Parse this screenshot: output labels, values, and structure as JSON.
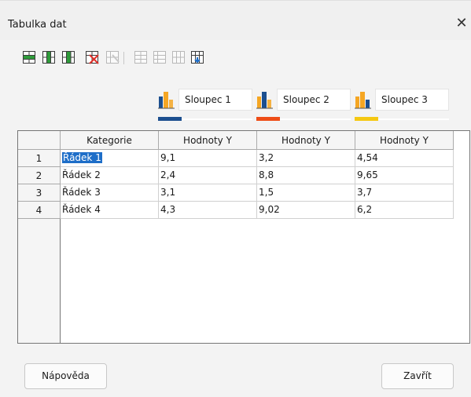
{
  "window": {
    "title": "Tabulka dat",
    "close_glyph": "✕"
  },
  "toolbar": {
    "icons": [
      "insert-row-icon",
      "insert-series-icon",
      "insert-text-column-icon",
      "delete-row-icon",
      "delete-series-icon",
      "move-row-up-icon",
      "move-row-down-icon",
      "move-series-left-icon",
      "move-series-right-icon"
    ]
  },
  "series": [
    {
      "name": "Sloupec 1",
      "color": "#1c4f8f"
    },
    {
      "name": "Sloupec 2",
      "color": "#ee4d17"
    },
    {
      "name": "Sloupec 3",
      "color": "#f5c812"
    }
  ],
  "table": {
    "headers": [
      "Kategorie",
      "Hodnoty Y",
      "Hodnoty Y",
      "Hodnoty Y"
    ],
    "rows": [
      {
        "num": "1",
        "category": "Řádek 1",
        "values": [
          "9,1",
          "3,2",
          "4,54"
        ]
      },
      {
        "num": "2",
        "category": "Řádek 2",
        "values": [
          "2,4",
          "8,8",
          "9,65"
        ]
      },
      {
        "num": "3",
        "category": "Řádek 3",
        "values": [
          "3,1",
          "1,5",
          "3,7"
        ]
      },
      {
        "num": "4",
        "category": "Řádek 4",
        "values": [
          "4,3",
          "9,02",
          "6,2"
        ]
      }
    ]
  },
  "buttons": {
    "help": "Nápověda",
    "close": "Zavřít"
  },
  "colors": {
    "selection": "#1e6ec8"
  }
}
